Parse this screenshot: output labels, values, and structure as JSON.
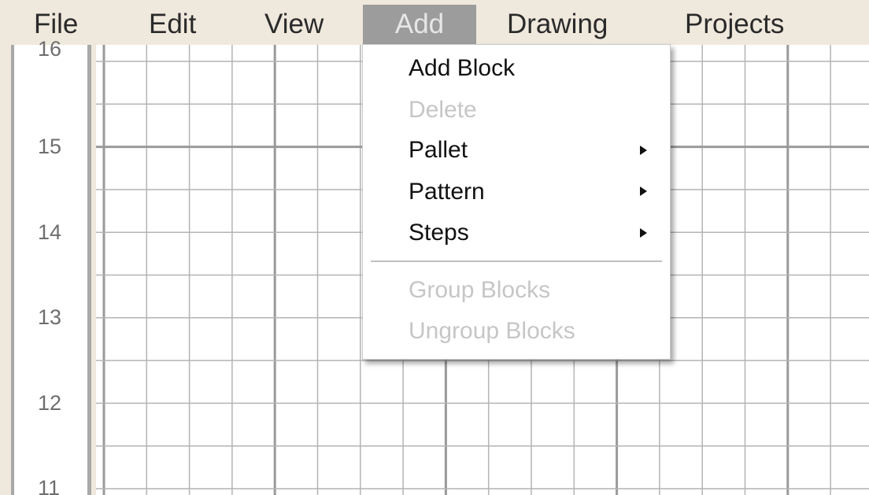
{
  "menubar": {
    "items": [
      {
        "label": "File"
      },
      {
        "label": "Edit"
      },
      {
        "label": "View"
      },
      {
        "label": "Add",
        "active": true
      },
      {
        "label": "Drawing"
      },
      {
        "label": "Projects"
      }
    ]
  },
  "ruler": {
    "ticks": [
      "16",
      "15",
      "14",
      "13",
      "12",
      "11"
    ]
  },
  "add_menu": {
    "items": [
      {
        "label": "Add Block",
        "enabled": true,
        "submenu": false
      },
      {
        "label": "Delete",
        "enabled": false,
        "submenu": false
      },
      {
        "label": "Pallet",
        "enabled": true,
        "submenu": true
      },
      {
        "label": "Pattern",
        "enabled": true,
        "submenu": true
      },
      {
        "label": "Steps",
        "enabled": true,
        "submenu": true
      },
      {
        "label": "Group Blocks",
        "enabled": false,
        "submenu": false
      },
      {
        "label": "Ungroup Blocks",
        "enabled": false,
        "submenu": false
      }
    ]
  },
  "colors": {
    "background": "#efe8dc",
    "active_menu": "#9c9c9c",
    "grid_line": "#b4b4b4",
    "grid_major": "#9a9a9a",
    "disabled_text": "#c6c6c6"
  },
  "icons": {
    "submenu": "submenu-arrow-icon"
  }
}
